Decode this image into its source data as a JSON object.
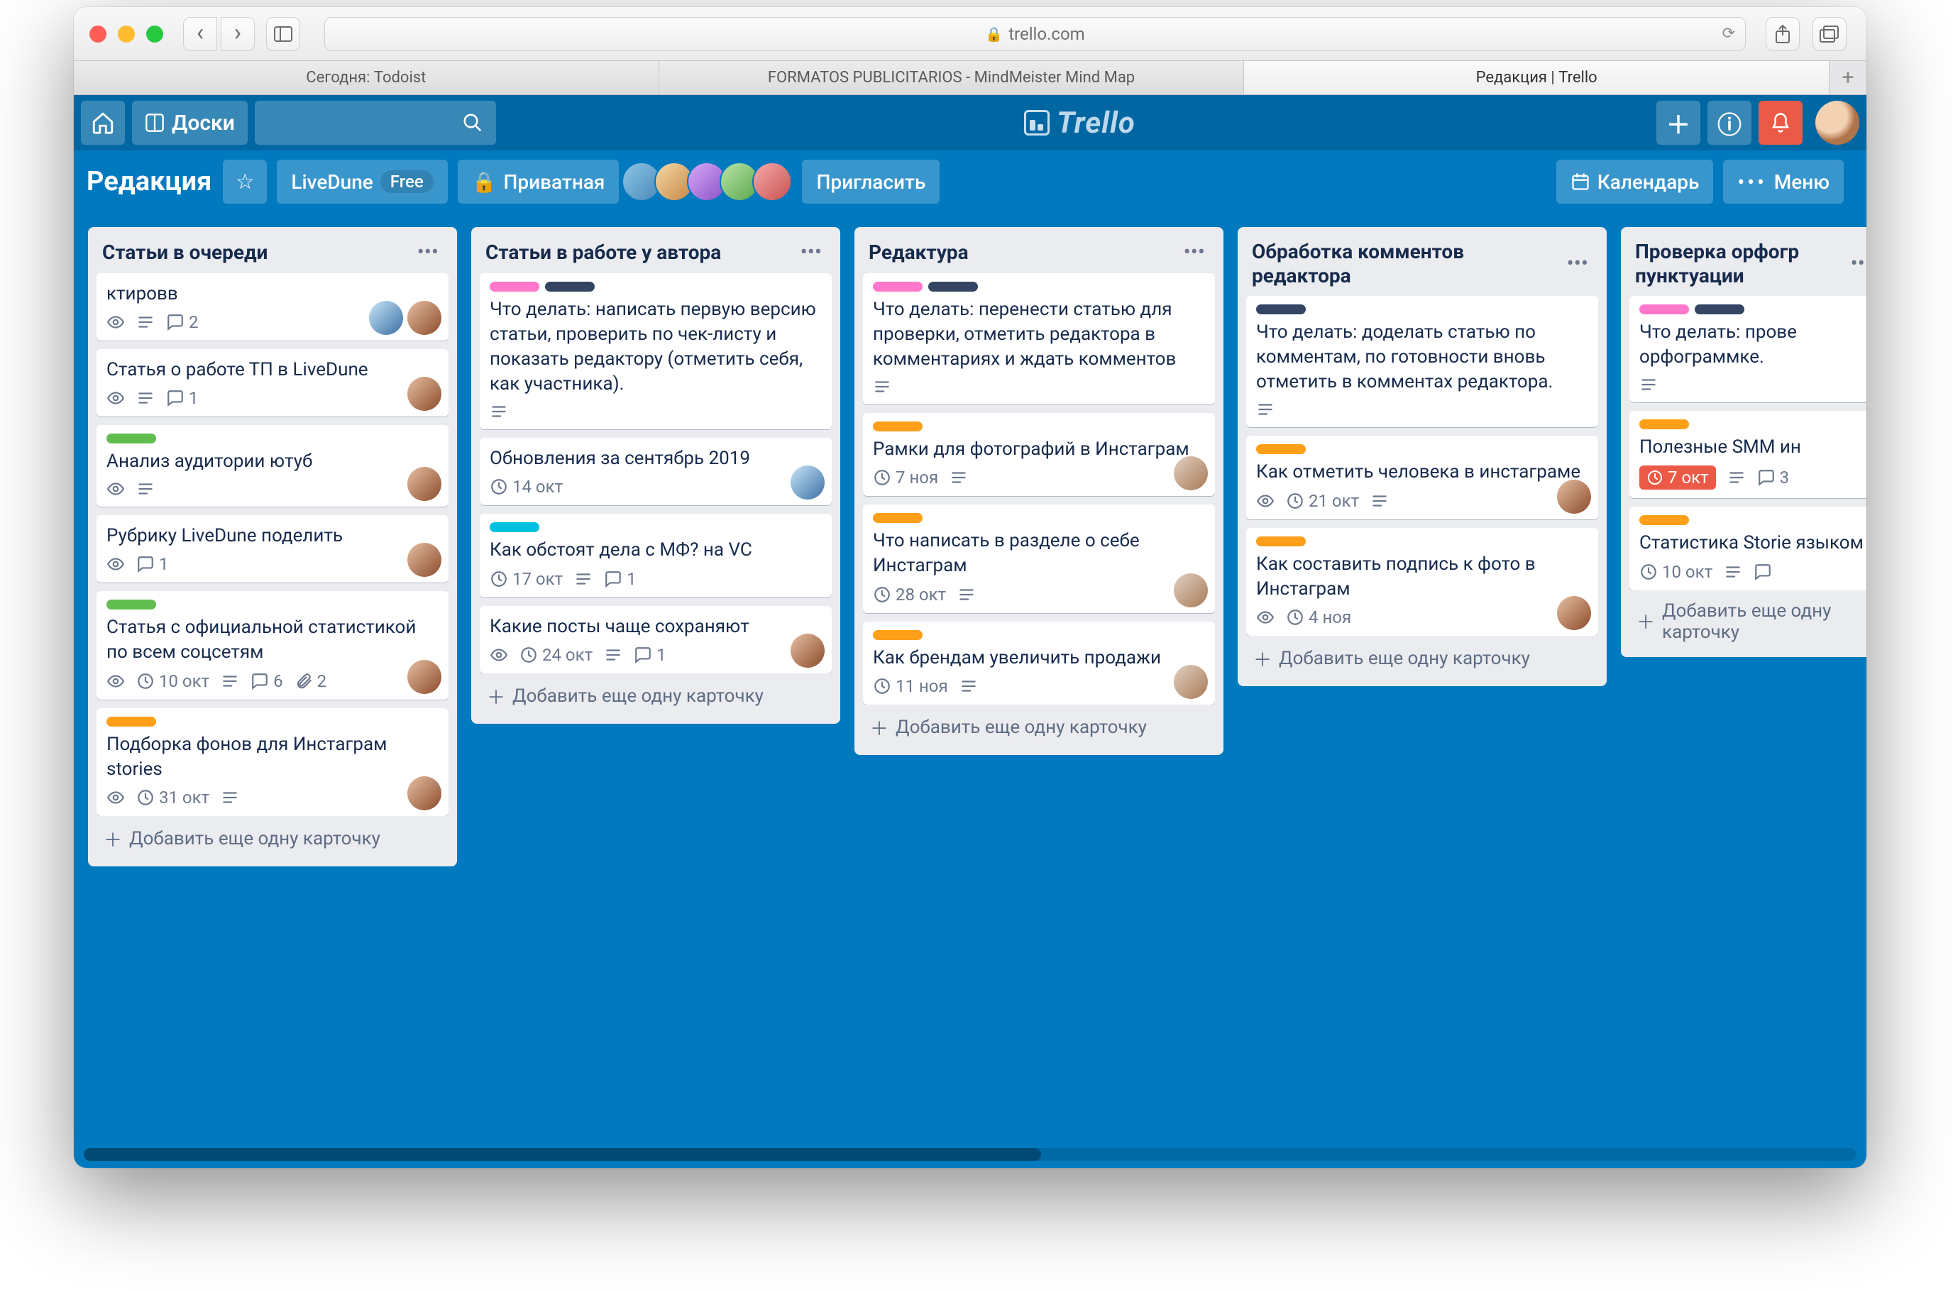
{
  "browser": {
    "address": "trello.com",
    "tabs": [
      {
        "label": "Сегодня: Todoist",
        "active": false
      },
      {
        "label": "FORMATOS PUBLICITARIOS - MindMeister Mind Map",
        "active": false
      },
      {
        "label": "Редакция | Trello",
        "active": true
      }
    ]
  },
  "trello_header": {
    "boards_button": "Доски",
    "logo": "Trello"
  },
  "board_bar": {
    "name": "Редакция",
    "team": "LiveDune",
    "team_pill": "Free",
    "visibility": "Приватная",
    "invite": "Пригласить",
    "calendar": "Календарь",
    "menu": "Меню"
  },
  "add_card_label": "Добавить еще одну карточку",
  "lists": [
    {
      "title": "Статьи в очереди",
      "cards": [
        {
          "title": "ктировв",
          "labels": [],
          "badges": [
            "watch",
            "desc"
          ],
          "comments": "2",
          "avatars": 2
        },
        {
          "title": "Статья о работе ТП в LiveDune",
          "labels": [],
          "badges": [
            "watch",
            "desc"
          ],
          "comments": "1",
          "avatars": 1
        },
        {
          "title": "Анализ аудитории ютуб",
          "labels": [
            "green"
          ],
          "badges": [
            "watch",
            "desc"
          ],
          "avatars": 1
        },
        {
          "title": "Рубрику LiveDune поделить",
          "labels": [],
          "badges": [
            "watch"
          ],
          "comments": "1",
          "avatars": 1
        },
        {
          "title": "Статья с официальной статистикой по всем соцсетям",
          "labels": [
            "green"
          ],
          "badges": [
            "watch"
          ],
          "due": "10 окт",
          "desc": true,
          "comments": "6",
          "attach": "2",
          "avatars": 1
        },
        {
          "title": "Подборка фонов для Инстаграм stories",
          "labels": [
            "orange"
          ],
          "badges": [
            "watch"
          ],
          "due": "31 окт",
          "desc": true,
          "avatars": 1
        }
      ]
    },
    {
      "title": "Статьи в работе у автора",
      "cards": [
        {
          "title": "Что делать: написать первую версию статьи, проверить по чек-листу и показать редактору (отметить себя, как участника).",
          "labels": [
            "pinkl",
            "navy"
          ],
          "badges": [
            "desc"
          ]
        },
        {
          "title": "Обновления за сентябрь 2019",
          "labels": [],
          "badges": [],
          "due": "14 окт",
          "avatars": 1,
          "avatar_alt": true
        },
        {
          "title": "Как обстоят дела с МФ? на VC",
          "labels": [
            "sky"
          ],
          "badges": [],
          "due": "17 окт",
          "desc": true,
          "comments": "1"
        },
        {
          "title": "Какие посты чаще сохраняют",
          "labels": [],
          "badges": [
            "watch"
          ],
          "due": "24 окт",
          "desc": true,
          "comments": "1",
          "avatars": 1
        }
      ]
    },
    {
      "title": "Редактура",
      "cards": [
        {
          "title": "Что делать: перенести статью для проверки, отметить редактора в комментариях и ждать комментов",
          "labels": [
            "pinkl",
            "navy"
          ],
          "badges": [
            "desc"
          ]
        },
        {
          "title": "Рамки для фотографий в Инстаграм",
          "labels": [
            "orange"
          ],
          "badges": [],
          "due": "7 ноя",
          "desc": true,
          "avatars": 1,
          "avatar_alt2": true
        },
        {
          "title": "Что написать в разделе о себе Инстаграм",
          "labels": [
            "orange"
          ],
          "badges": [],
          "due": "28 окт",
          "desc": true,
          "avatars": 1,
          "avatar_alt2": true
        },
        {
          "title": "Как брендам увеличить продажи",
          "labels": [
            "orange"
          ],
          "badges": [],
          "due": "11 ноя",
          "desc": true,
          "avatars": 1,
          "avatar_alt2": true
        }
      ]
    },
    {
      "title": "Обработка комментов редактора",
      "cards": [
        {
          "title": "Что делать: доделать статью по комментам, по готовности вновь отметить в комментах редактора.",
          "labels": [
            "navy"
          ],
          "badges": [
            "desc"
          ]
        },
        {
          "title": "Как отметить человека в инстаграме",
          "labels": [
            "orange"
          ],
          "badges": [
            "watch"
          ],
          "due": "21 окт",
          "desc": true,
          "avatars": 1
        },
        {
          "title": "Как составить подпись к фото в Инстаграм",
          "labels": [
            "orange"
          ],
          "badges": [
            "watch"
          ],
          "due": "4 ноя",
          "avatars": 1
        }
      ]
    },
    {
      "title": "Проверка орфогр пунктуации",
      "cards": [
        {
          "title": "Что делать: прове орфограммке.",
          "labels": [
            "pinkl",
            "navy"
          ],
          "badges": [
            "desc"
          ]
        },
        {
          "title": "Полезные SMM ин",
          "labels": [
            "orange"
          ],
          "badges": [],
          "due": "7 окт",
          "due_red": true,
          "desc": true,
          "comments": "3"
        },
        {
          "title": "Статистика Storie языком",
          "labels": [
            "orange"
          ],
          "badges": [],
          "due": "10 окт",
          "desc": true,
          "comments": ""
        }
      ]
    }
  ]
}
